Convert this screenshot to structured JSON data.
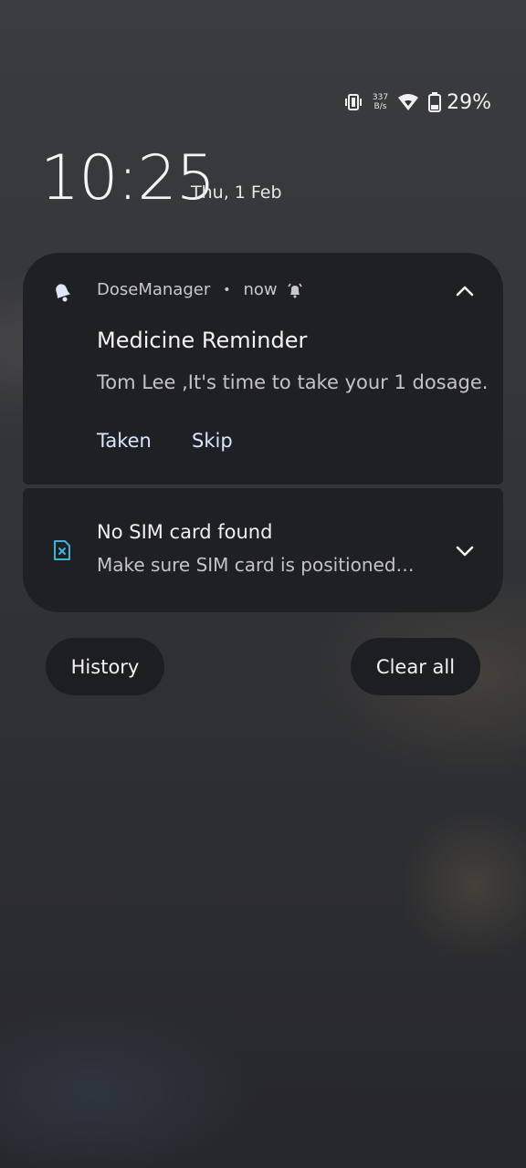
{
  "status_bar": {
    "net_speed_value": "337",
    "net_speed_unit": "B/s",
    "battery": "29%",
    "icons": [
      "vibrate-icon",
      "wifi-icon",
      "battery-icon"
    ]
  },
  "lockscreen": {
    "time": "10:25",
    "date": "Thu, 1 Feb"
  },
  "notifications": [
    {
      "app_name": "DoseManager",
      "separator": "•",
      "time": "now",
      "icon": "bell-icon",
      "title": "Medicine Reminder",
      "body": "Tom Lee ,It's time to take your 1 dosage.",
      "actions": [
        "Taken",
        "Skip"
      ]
    },
    {
      "icon": "sim-card-icon",
      "title": "No SIM card found",
      "body": "Make sure SIM card is positioned…"
    }
  ],
  "buttons": {
    "history": "History",
    "clear_all": "Clear all"
  },
  "colors": {
    "card_bg": "#1f2024",
    "action_text": "#d9e6ff",
    "sim_icon": "#3ab4d8"
  }
}
